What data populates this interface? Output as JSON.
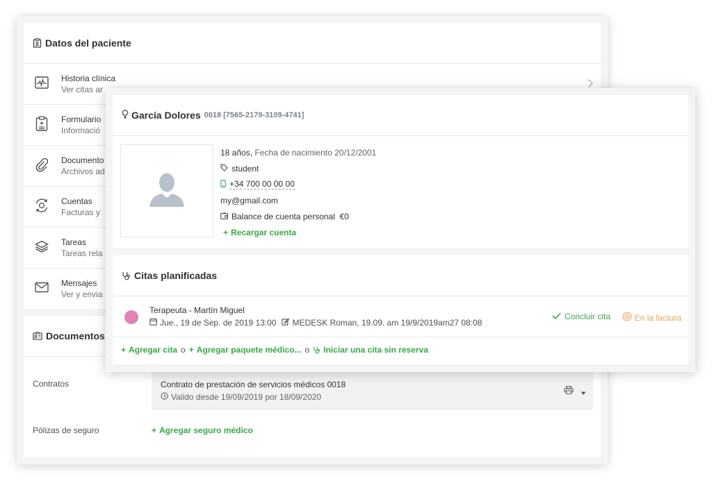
{
  "patient_data_card": {
    "title": "Datos del paciente",
    "items": [
      {
        "title": "Historia clínica",
        "subtitle": "Ver citas ar",
        "icon": "heart-monitor-icon"
      },
      {
        "title": "Formulario",
        "subtitle": "Informació",
        "icon": "clipboard-icon"
      },
      {
        "title": "Documento",
        "subtitle": "Archivos ad",
        "icon": "paperclip-icon"
      },
      {
        "title": "Cuentas",
        "subtitle": "Facturas y",
        "icon": "money-cycle-icon"
      },
      {
        "title": "Tareas",
        "subtitle": "Tareas rela",
        "icon": "layers-icon"
      },
      {
        "title": "Mensajes",
        "subtitle": "Ver y envia",
        "icon": "envelope-icon"
      }
    ]
  },
  "documents_card": {
    "title": "Documentos",
    "contracts_label": "Contratos",
    "contract_title": "Contrato de prestación de servicios médicos 0018",
    "contract_valid": "Valido desde 19/09/2019 por 18/09/2020",
    "policies_label": "Pólizas de seguro",
    "add_insurance": "Agregar seguro médico"
  },
  "patient_card": {
    "name": "García Dolores",
    "id": "0018 [7565-2179-3109-4741]",
    "age": "18 años,",
    "birth_label": "Fecha de nacimiento 20/12/2001",
    "tag": "student",
    "phone": "+34 700 00 00 00",
    "email": "my@gmail.com",
    "balance_label": "Balance de cuenta personal",
    "balance_value": "€0",
    "recharge": "Recargar cuenta"
  },
  "appointments_card": {
    "title": "Citas planificadas",
    "appointment": {
      "title": "Terapeuta - Martín Miguel",
      "date": "Jue., 19 de Sep. de 2019 13:00",
      "note": "MEDESK Roman, 19.09. am 19/9/2019am27 08:08",
      "dot_color": "#e083b7"
    },
    "conclude": "Concluir cita",
    "invoice": "En la factura",
    "add_appointment": "Agregar cita",
    "or": "o",
    "add_package": "Agregar paquete médico...",
    "start_unbooked": "Iniciar una cita sin reserva"
  },
  "colors": {
    "accent_green": "#3aa64a",
    "invoice_orange": "#e3a45a"
  }
}
